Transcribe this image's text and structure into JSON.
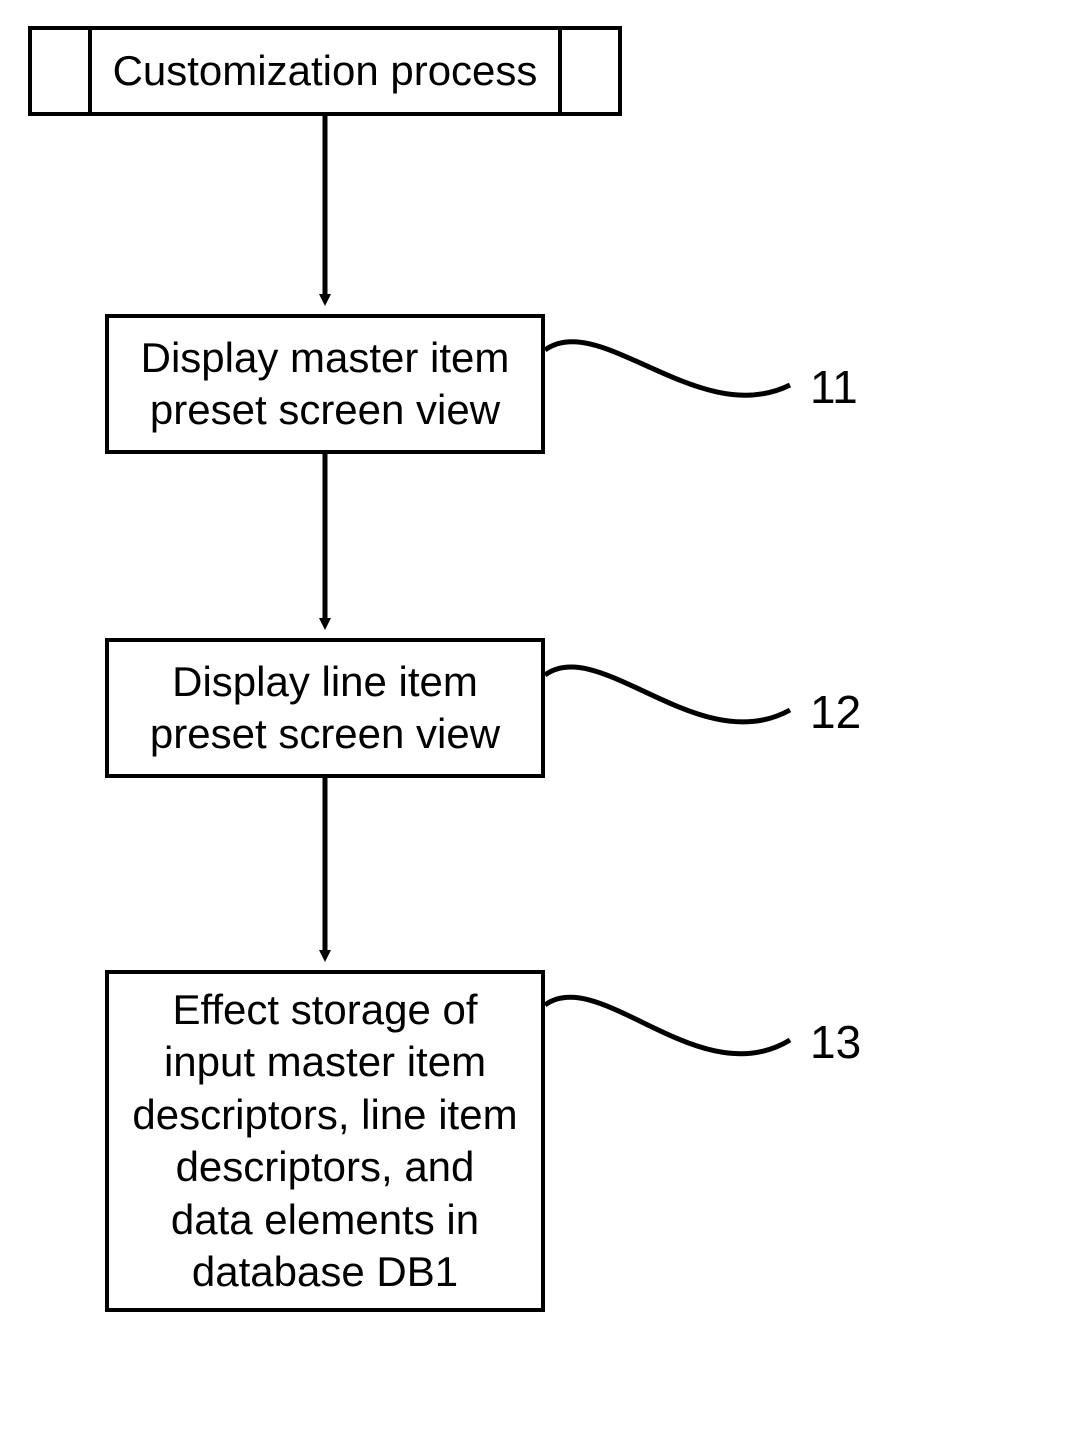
{
  "diagram": {
    "title_box": {
      "text": "Customization process"
    },
    "steps": [
      {
        "text": "Display master item preset screen view",
        "ref": "11"
      },
      {
        "text": "Display line item preset screen view",
        "ref": "12"
      },
      {
        "text": "Effect storage of input master item descriptors, line item descriptors, and data elements in database DB1",
        "ref": "13"
      }
    ]
  }
}
